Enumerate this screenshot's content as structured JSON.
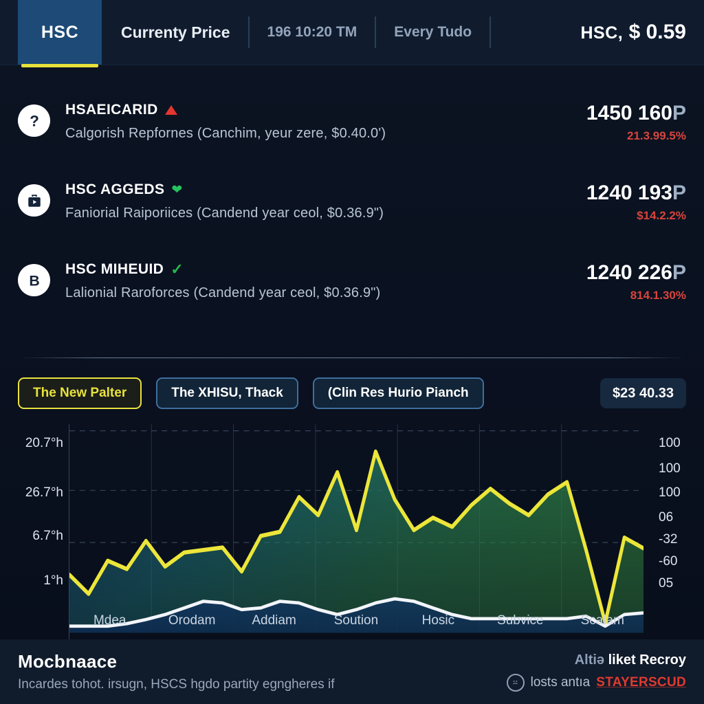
{
  "header": {
    "tab_label": "HSC",
    "items": [
      {
        "text": "Currenty Price",
        "style": "strong"
      },
      {
        "text": "196 10:20 TM",
        "style": "muted"
      },
      {
        "text": "Every Tudo",
        "style": "muted"
      }
    ],
    "price_symbol": "HSC,",
    "price_value": "$ 0.59"
  },
  "list": [
    {
      "icon": "question-mark-icon",
      "title": "HSAEICARID",
      "badge": "triangle-up-red",
      "subtitle": "Calgorish Repfornes (Canchim, yeur zere, $0.40.0')",
      "value": "1450 160",
      "unit": "P",
      "change": "21.3.99.5%"
    },
    {
      "icon": "briefcase-play-icon",
      "title": "HSC AGGEDS",
      "badge": "heart-green",
      "subtitle": "Faniorial Raiporiices (Candend year ceol, $0.36.9\")",
      "value": "1240 193",
      "unit": "P",
      "change": "$14.2.2%"
    },
    {
      "icon": "letter-b-icon",
      "title": "HSC MIHEUID",
      "badge": "check-green",
      "subtitle": "Lalionial Raroforces (Candend year ceol, $0.36.9\")",
      "value": "1240 226",
      "unit": "P",
      "change": "814.1.30%"
    }
  ],
  "filters": {
    "chips": [
      {
        "label": "The New Palter",
        "active": true
      },
      {
        "label": "The XHISU, Thack",
        "active": false
      },
      {
        "label": "(Clin Res Hurio Pianch",
        "active": false
      }
    ],
    "price_badge": "$23 40.33"
  },
  "chart_data": {
    "type": "area",
    "title": "",
    "xlabel": "",
    "ylabel": "",
    "grid": true,
    "legend": "none",
    "categories": [
      "Mdea",
      "Orodam",
      "Addiam",
      "Soution",
      "Hosic",
      "Subvice",
      "Scalam"
    ],
    "y_left_ticks": [
      "20.7°h",
      "26.7°h",
      "6.7°h",
      "1°h"
    ],
    "y_right_ticks": [
      "100",
      "100",
      "100",
      "06",
      "-32",
      "-60",
      "05"
    ],
    "series": [
      {
        "name": "primary-yellow",
        "color": "#ece63a",
        "fill": "blue-green-gradient",
        "values": [
          30,
          21,
          35,
          31,
          44,
          33,
          38,
          39,
          40,
          32,
          46,
          48,
          63,
          56,
          75,
          52,
          84,
          66,
          52,
          57,
          53,
          62,
          70,
          63,
          58,
          67,
          72,
          42,
          12,
          45,
          40
        ]
      },
      {
        "name": "secondary-white",
        "color": "#f2f5fa",
        "values": [
          6,
          6,
          6,
          7,
          9,
          11,
          14,
          17,
          16,
          13,
          14,
          17,
          16,
          13,
          11,
          13,
          16,
          18,
          17,
          14,
          11,
          9,
          9,
          9,
          9,
          9,
          9,
          10,
          6,
          11,
          12
        ]
      }
    ],
    "ylim": [
      0,
      100
    ]
  },
  "footer": {
    "title": "Mocbnaace",
    "subtitle": "Incardes tohot. irsugn, HSCS hgdo partity egngheres if",
    "right_top_dim": "Altiə",
    "right_top_strong": "liket Recroy",
    "right_icon": "face-circle-icon",
    "right_bottom_text": "losts antıa",
    "right_bottom_brand": "STAYERSCUD"
  }
}
